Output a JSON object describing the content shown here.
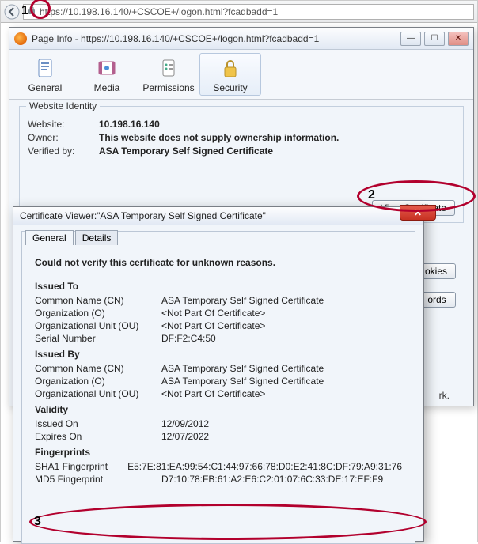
{
  "browser": {
    "url": "https://10.198.16.140/+CSCOE+/logon.html?fcadbadd=1"
  },
  "pageinfo": {
    "title": "Page Info - https://10.198.16.140/+CSCOE+/logon.html?fcadbadd=1",
    "toolbar": {
      "general": "General",
      "media": "Media",
      "permissions": "Permissions",
      "security": "Security"
    },
    "identity": {
      "legend": "Website Identity",
      "website_label": "Website:",
      "website_value": "10.198.16.140",
      "owner_label": "Owner:",
      "owner_value": "This website does not supply ownership information.",
      "verifiedby_label": "Verified by:",
      "verifiedby_value": "ASA Temporary Self Signed Certificate",
      "view_cert_btn": "View Certificate"
    },
    "side_buttons": {
      "cookies": "okies",
      "passwords": "ords"
    },
    "side_text": "rk."
  },
  "certviewer": {
    "title": "Certificate Viewer:\"ASA Temporary Self Signed Certificate\"",
    "tabs": {
      "general": "General",
      "details": "Details"
    },
    "warn": "Could not verify this certificate for unknown reasons.",
    "sections": {
      "issued_to": "Issued To",
      "issued_by": "Issued By",
      "validity": "Validity",
      "fingerprints": "Fingerprints"
    },
    "labels": {
      "cn": "Common Name (CN)",
      "o": "Organization (O)",
      "ou": "Organizational Unit (OU)",
      "serial": "Serial Number",
      "issued_on": "Issued On",
      "expires_on": "Expires On",
      "sha1": "SHA1 Fingerprint",
      "md5": "MD5 Fingerprint"
    },
    "issued_to": {
      "cn": "ASA Temporary Self Signed Certificate",
      "o": "<Not Part Of Certificate>",
      "ou": "<Not Part Of Certificate>",
      "serial": "DF:F2:C4:50"
    },
    "issued_by": {
      "cn": "ASA Temporary Self Signed Certificate",
      "o": "ASA Temporary Self Signed Certificate",
      "ou": "<Not Part Of Certificate>"
    },
    "validity": {
      "issued_on": "12/09/2012",
      "expires_on": "12/07/2022"
    },
    "fingerprints": {
      "sha1": "E5:7E:81:EA:99:54:C1:44:97:66:78:D0:E2:41:8C:DF:79:A9:31:76",
      "md5": "D7:10:78:FB:61:A2:E6:C2:01:07:6C:33:DE:17:EF:F9"
    }
  },
  "annotations": {
    "n1": "1",
    "n2": "2",
    "n3": "3"
  }
}
